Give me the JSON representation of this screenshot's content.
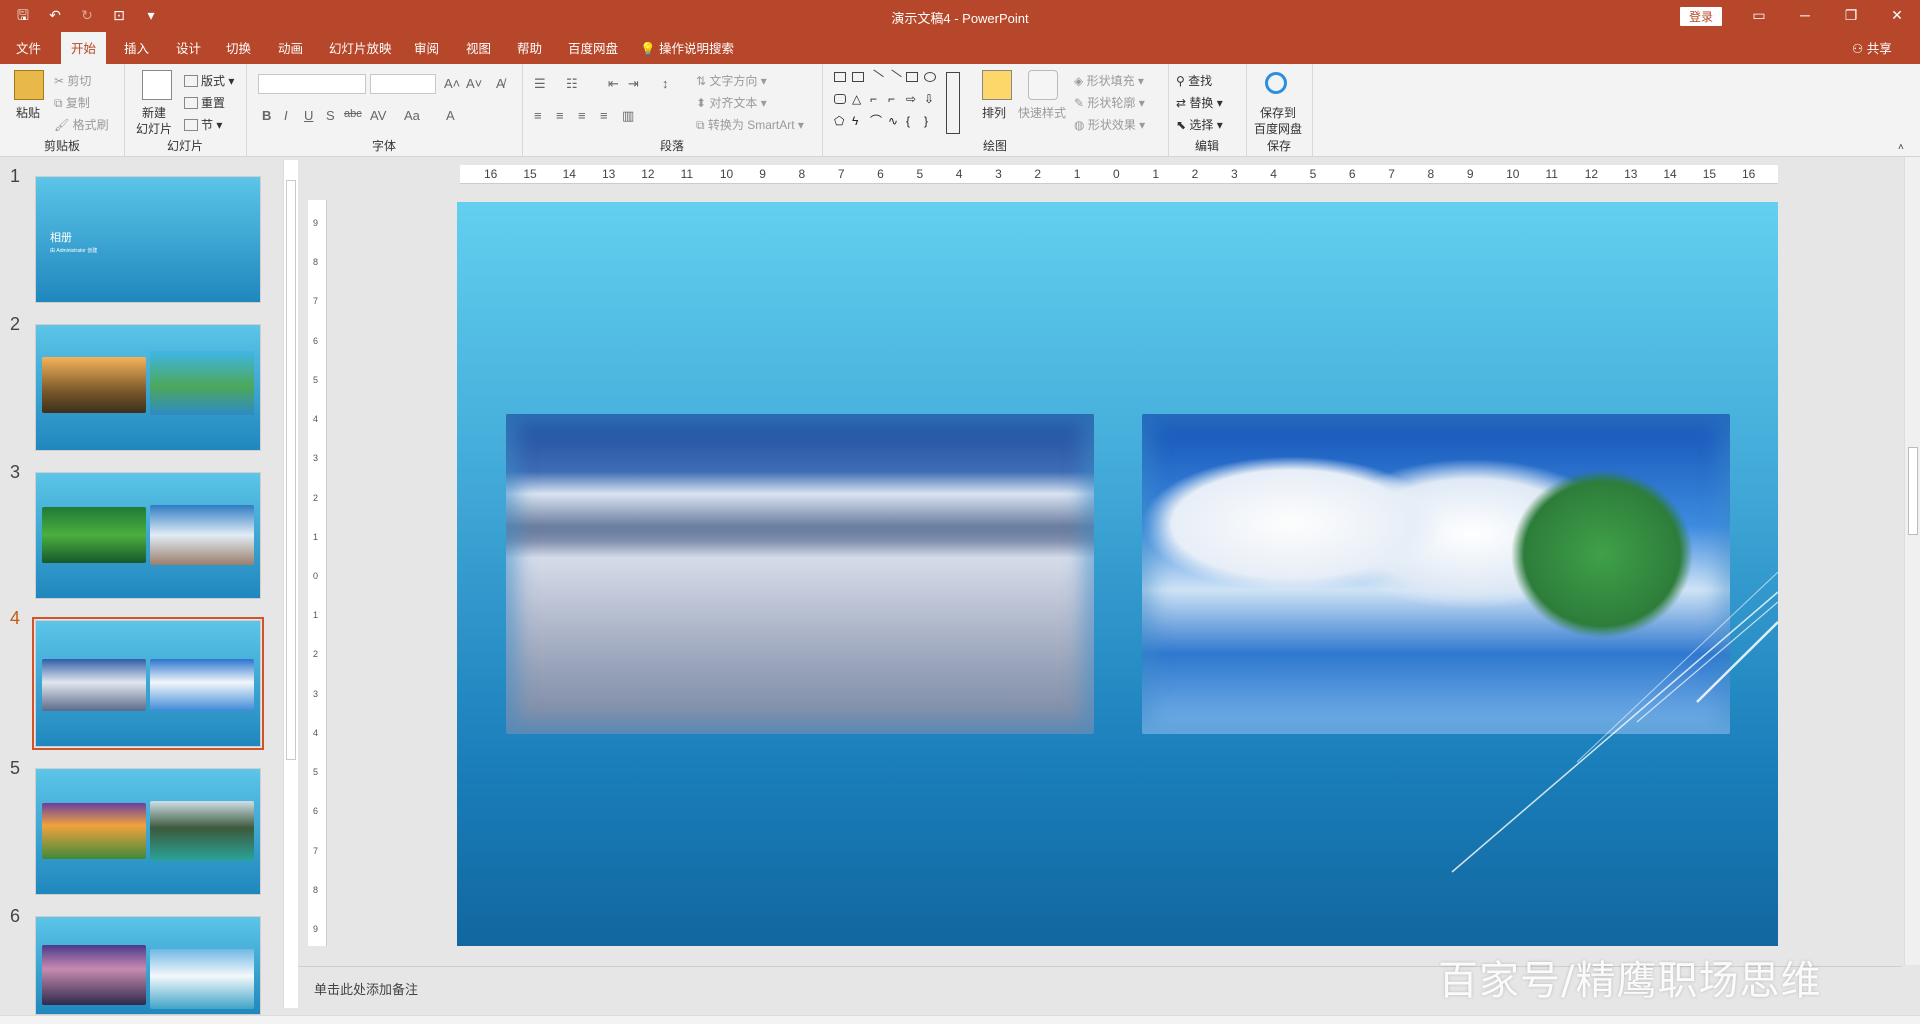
{
  "window": {
    "title": "演示文稿4 - PowerPoint",
    "login_label": "登录",
    "qat": [
      "save",
      "undo",
      "redo",
      "start-from-beginning",
      "customize"
    ],
    "controls": {
      "restore_ribbon": "▭",
      "minimize": "─",
      "maximize": "❐",
      "close": "✕"
    }
  },
  "tabs": [
    {
      "label": "文件"
    },
    {
      "label": "开始"
    },
    {
      "label": "插入"
    },
    {
      "label": "设计"
    },
    {
      "label": "切换"
    },
    {
      "label": "动画"
    },
    {
      "label": "幻灯片放映"
    },
    {
      "label": "审阅"
    },
    {
      "label": "视图"
    },
    {
      "label": "帮助"
    },
    {
      "label": "百度网盘"
    }
  ],
  "tellme": "操作说明搜索",
  "share": "共享",
  "ribbon": {
    "clipboard": {
      "paste": "粘贴",
      "cut": "剪切",
      "copy": "复制",
      "format_painter": "格式刷",
      "label": "剪贴板"
    },
    "slides": {
      "new_slide_1": "新建",
      "new_slide_2": "幻灯片",
      "layout": "版式",
      "reset": "重置",
      "section": "节",
      "label": "幻灯片"
    },
    "font": {
      "label": "字体"
    },
    "paragraph": {
      "text_direction": "文字方向",
      "align_text": "对齐文本",
      "smartart": "转换为 SmartArt",
      "label": "段落"
    },
    "drawing": {
      "arrange": "排列",
      "quick_styles": "快速样式",
      "shape_fill": "形状填充",
      "shape_outline": "形状轮廓",
      "shape_effects": "形状效果",
      "label": "绘图"
    },
    "editing": {
      "find": "查找",
      "replace": "替换",
      "select": "选择",
      "label": "编辑"
    },
    "save": {
      "line1": "保存到",
      "line2": "百度网盘",
      "label": "保存"
    }
  },
  "ruler": {
    "h_ticks": [
      "16",
      "15",
      "14",
      "13",
      "12",
      "11",
      "10",
      "9",
      "8",
      "7",
      "6",
      "5",
      "4",
      "3",
      "2",
      "1",
      "0",
      "1",
      "2",
      "3",
      "4",
      "5",
      "6",
      "7",
      "8",
      "9",
      "10",
      "11",
      "12",
      "13",
      "14",
      "15",
      "16"
    ],
    "v_ticks": [
      "9",
      "8",
      "7",
      "6",
      "5",
      "4",
      "3",
      "2",
      "1",
      "0",
      "1",
      "2",
      "3",
      "4",
      "5",
      "6",
      "7",
      "8",
      "9"
    ]
  },
  "thumbnails": [
    {
      "num": "1",
      "title": "相册",
      "subtitle": "由 Administrator 创建",
      "selected": false
    },
    {
      "num": "2",
      "selected": false
    },
    {
      "num": "3",
      "selected": false
    },
    {
      "num": "4",
      "selected": true
    },
    {
      "num": "5",
      "selected": false
    },
    {
      "num": "6",
      "selected": false
    }
  ],
  "notes_placeholder": "单击此处添加备注",
  "watermark": "百家号/精鹰职场思维",
  "colors": {
    "accent": "#b7472a",
    "selection": "#d0532c"
  }
}
